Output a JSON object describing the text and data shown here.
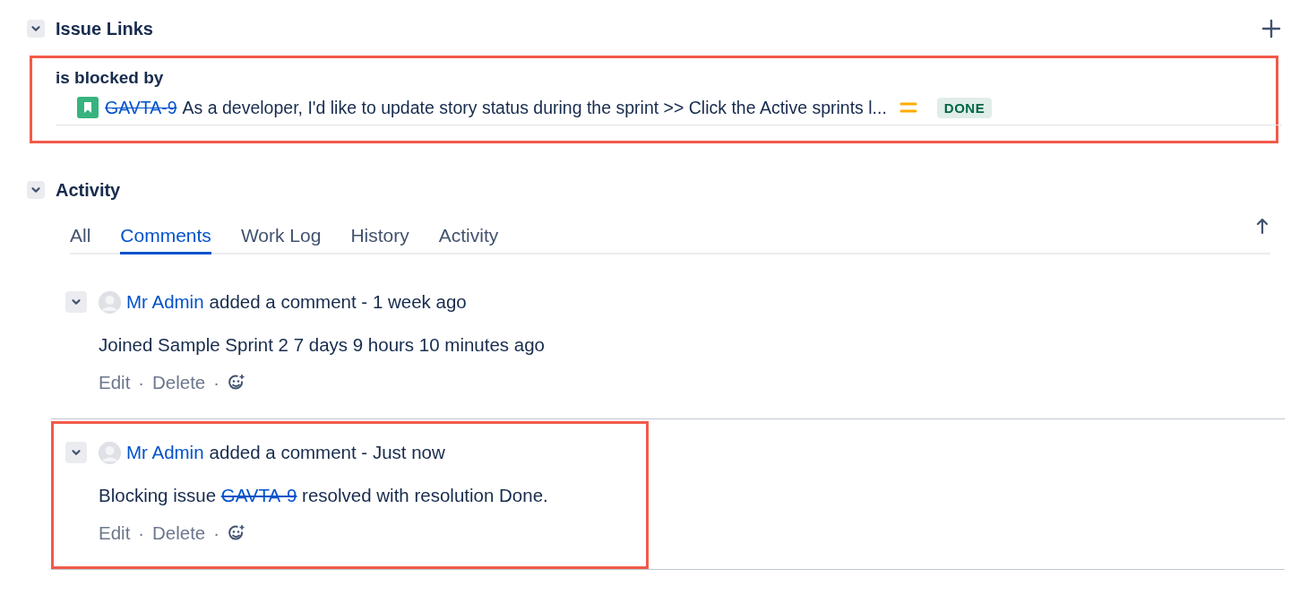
{
  "issue_links": {
    "title": "Issue Links",
    "expanded": true,
    "groups": [
      {
        "relation": "is blocked by",
        "highlighted": true,
        "links": [
          {
            "key": "GAVTA-9",
            "resolved": true,
            "summary": "As a developer, I'd like to update story status during the sprint >> Click the Active sprints l...",
            "priority": {
              "kind": "medium",
              "color": "#ffab00"
            },
            "status": {
              "label": "DONE",
              "color": "#006644"
            }
          }
        ]
      }
    ]
  },
  "activity": {
    "title": "Activity",
    "expanded": true,
    "tabs": [
      {
        "label": "All",
        "selected": false
      },
      {
        "label": "Comments",
        "selected": true
      },
      {
        "label": "Work Log",
        "selected": false
      },
      {
        "label": "History",
        "selected": false
      },
      {
        "label": "Activity",
        "selected": false
      }
    ],
    "comments": [
      {
        "expanded": true,
        "highlighted": false,
        "author": "Mr Admin",
        "action": "added a comment - 1 week ago",
        "body": [
          {
            "kind": "text",
            "text": "Joined Sample Sprint 2 7 days 9 hours 10 minutes ago"
          }
        ],
        "actions": [
          {
            "kind": "link",
            "text": "Edit"
          },
          {
            "kind": "separator",
            "text": "·"
          },
          {
            "kind": "link",
            "text": "Delete"
          },
          {
            "kind": "separator",
            "text": "·"
          },
          {
            "kind": "reaction"
          }
        ]
      },
      {
        "expanded": true,
        "highlighted": true,
        "author": "Mr Admin",
        "action": "added a comment - Just now",
        "body": [
          {
            "kind": "text",
            "text": "Blocking issue "
          },
          {
            "kind": "issue",
            "text": "GAVTA-9",
            "resolved": true
          },
          {
            "kind": "text",
            "text": " resolved with resolution Done."
          }
        ],
        "actions": [
          {
            "kind": "link",
            "text": "Edit"
          },
          {
            "kind": "separator",
            "text": "·"
          },
          {
            "kind": "link",
            "text": "Delete"
          },
          {
            "kind": "separator",
            "text": "·"
          },
          {
            "kind": "reaction"
          }
        ]
      }
    ]
  }
}
